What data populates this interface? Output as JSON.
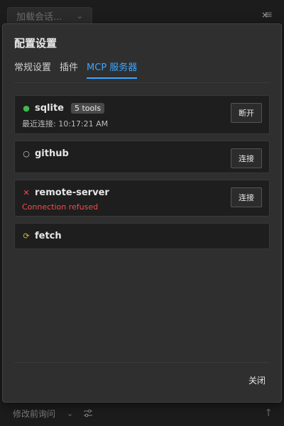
{
  "background": {
    "session_select_placeholder": "加载会话...",
    "mode_select_value": "修改前询问"
  },
  "modal": {
    "title": "配置设置",
    "tabs": [
      {
        "label": "常规设置",
        "active": false
      },
      {
        "label": "插件",
        "active": false
      },
      {
        "label": "MCP 服务器",
        "active": true
      }
    ],
    "servers": [
      {
        "name": "sqlite",
        "status": "connected",
        "status_icon": "●",
        "status_color": "#3fb950",
        "tools_badge": "5 tools",
        "subtitle": "最近连接: 10:17:21 AM",
        "error": "",
        "action_label": "断开"
      },
      {
        "name": "github",
        "status": "disconnected",
        "status_icon": "○",
        "status_color": "#cfcfcf",
        "tools_badge": "",
        "subtitle": "",
        "error": "",
        "action_label": "连接"
      },
      {
        "name": "remote-server",
        "status": "error",
        "status_icon": "✕",
        "status_color": "#f14c4c",
        "tools_badge": "",
        "subtitle": "",
        "error": "Connection refused",
        "action_label": "连接"
      },
      {
        "name": "fetch",
        "status": "connecting",
        "status_icon": "⟳",
        "status_color": "#d7ba1e",
        "tools_badge": "",
        "subtitle": "",
        "error": "",
        "action_label": ""
      }
    ],
    "close_label": "关闭",
    "close_x": "×"
  },
  "colors": {
    "accent": "#3ea6ff",
    "connected": "#3fb950",
    "error": "#f14c4c",
    "connecting": "#d7ba1e"
  }
}
